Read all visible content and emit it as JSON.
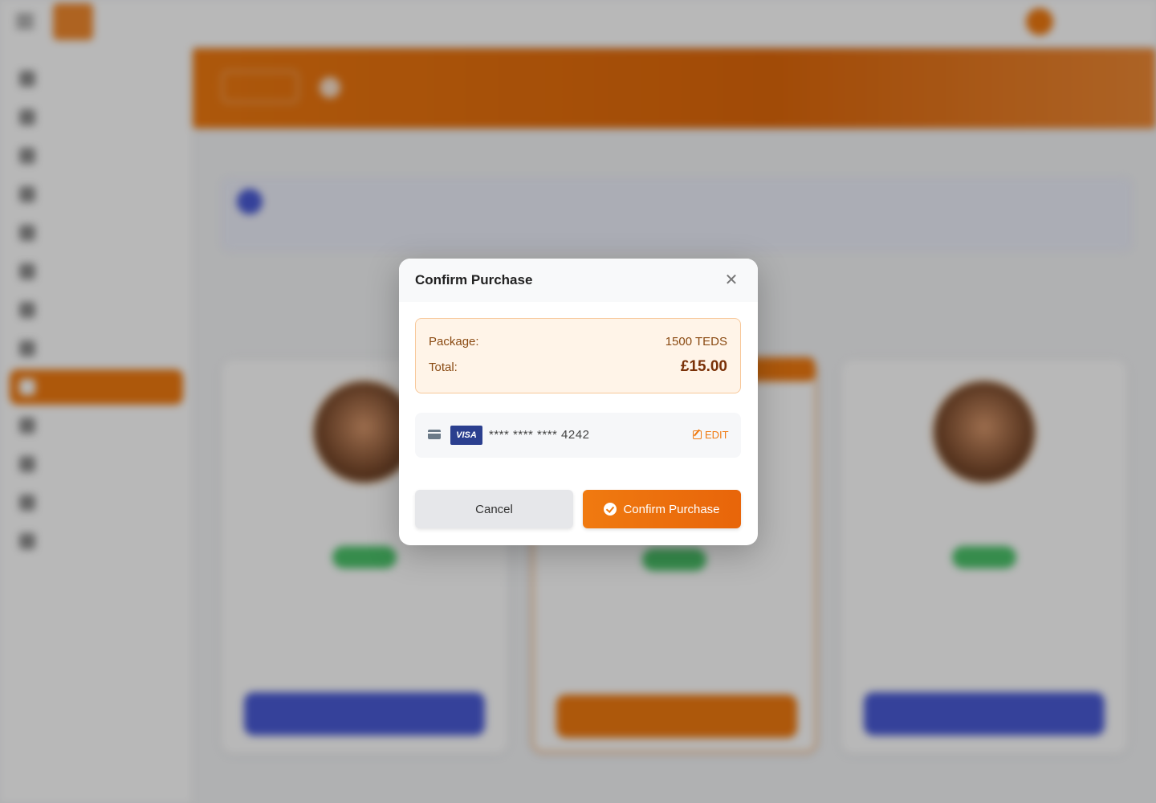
{
  "background": {
    "header": {
      "brand": "",
      "brand_sub": "",
      "user_name": "",
      "user_role": ""
    },
    "sidebar": {
      "items": [
        {
          "label": ""
        },
        {
          "label": ""
        },
        {
          "label": ""
        },
        {
          "label": ""
        },
        {
          "label": ""
        },
        {
          "label": ""
        },
        {
          "label": ""
        },
        {
          "label": ""
        },
        {
          "label": "",
          "active": true
        },
        {
          "label": ""
        },
        {
          "label": ""
        },
        {
          "label": ""
        },
        {
          "label": ""
        }
      ]
    },
    "hero": {
      "button": "",
      "title": "",
      "subtitle": ""
    },
    "info": {
      "title": "",
      "text": ""
    },
    "section": {
      "title": "",
      "subtitle": ""
    },
    "cards": [
      {
        "amount": "",
        "unit": "",
        "price": "",
        "note": "",
        "description": "",
        "button": ""
      },
      {
        "amount": "",
        "unit": "",
        "price": "",
        "note": "",
        "description": "",
        "button": "",
        "featured": true
      },
      {
        "amount": "",
        "unit": "",
        "price": "",
        "note": "",
        "description": "",
        "button": ""
      }
    ]
  },
  "modal": {
    "title": "Confirm Purchase",
    "close_icon": "close-icon",
    "summary": {
      "package_label": "Package:",
      "package_value": "1500 TEDS",
      "total_label": "Total:",
      "total_value": "£15.00"
    },
    "payment": {
      "card_icon": "credit-card-icon",
      "brand": "VISA",
      "masked_number": "**** **** **** 4242",
      "edit_label": "EDIT"
    },
    "buttons": {
      "cancel": "Cancel",
      "confirm": "Confirm Purchase"
    }
  },
  "colors": {
    "accent": "#f07a10",
    "summary_bg": "#fff4e8",
    "summary_text": "#8a4a12",
    "visa_blue": "#2b3f8f"
  }
}
